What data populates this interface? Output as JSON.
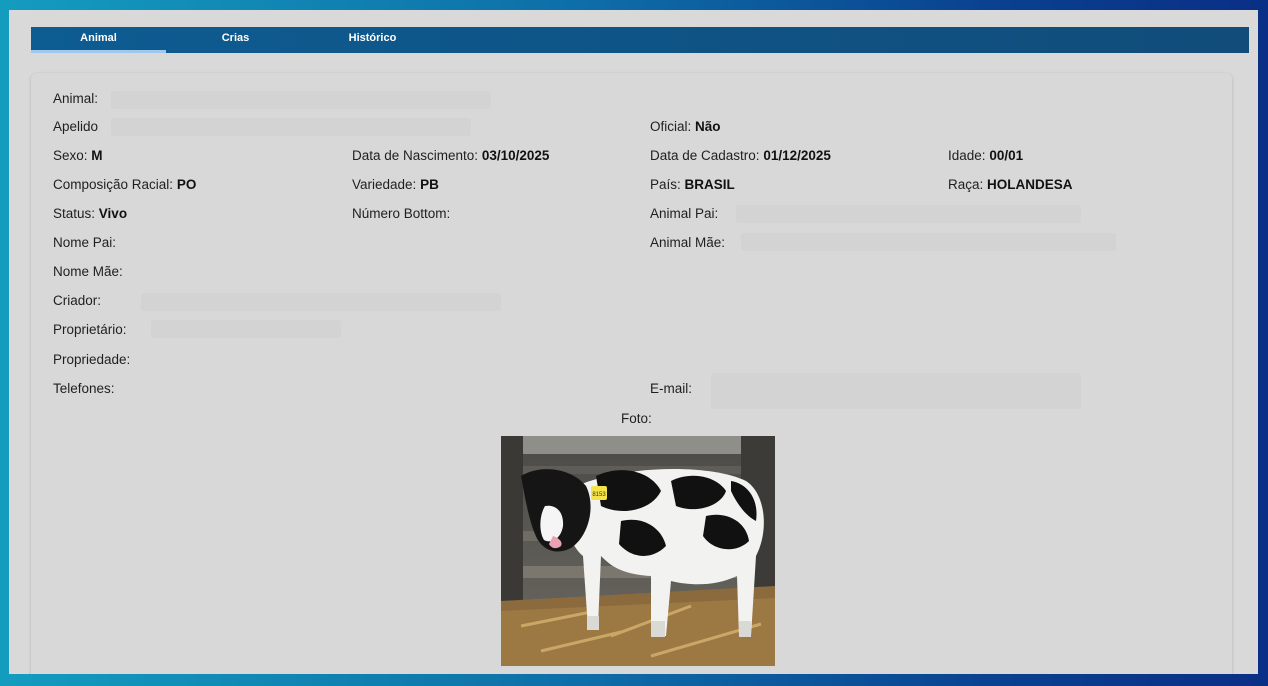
{
  "tabs": [
    {
      "label": "Animal",
      "active": true
    },
    {
      "label": "Crias",
      "active": false
    },
    {
      "label": "Histórico",
      "active": false
    }
  ],
  "fields": {
    "animal": {
      "label": "Animal:",
      "value": ""
    },
    "apelido": {
      "label": "Apelido",
      "value": ""
    },
    "oficial": {
      "label": "Oficial:",
      "value": "Não"
    },
    "sexo": {
      "label": "Sexo:",
      "value": "M"
    },
    "nascimento": {
      "label": "Data de Nascimento:",
      "value": "03/10/2025"
    },
    "cadastro": {
      "label": "Data de Cadastro:",
      "value": "01/12/2025"
    },
    "idade": {
      "label": "Idade:",
      "value": "00/01"
    },
    "composicao": {
      "label": "Composição Racial:",
      "value": "PO"
    },
    "variedade": {
      "label": "Variedade:",
      "value": "PB"
    },
    "pais": {
      "label": "País:",
      "value": "BRASIL"
    },
    "raca": {
      "label": "Raça:",
      "value": "HOLANDESA"
    },
    "status": {
      "label": "Status:",
      "value": "Vivo"
    },
    "bottom": {
      "label": "Número Bottom:",
      "value": ""
    },
    "animal_pai": {
      "label": "Animal Pai:",
      "value": ""
    },
    "nome_pai": {
      "label": "Nome Pai:",
      "value": ""
    },
    "animal_mae": {
      "label": "Animal Mãe:",
      "value": ""
    },
    "nome_mae": {
      "label": "Nome Mãe:",
      "value": ""
    },
    "criador": {
      "label": "Criador:",
      "value": ""
    },
    "proprietario": {
      "label": "Proprietário:",
      "value": ""
    },
    "propriedade": {
      "label": "Propriedade:",
      "value": ""
    },
    "telefones": {
      "label": "Telefones:",
      "value": ""
    },
    "email": {
      "label": "E-mail:",
      "value": ""
    }
  },
  "photo": {
    "label": "Foto:",
    "ear_tag": "8153"
  },
  "colors": {
    "tabbar": "#0d5c92",
    "panel": "#d8d8d8",
    "active_tab_underline": "#9fc8ea"
  }
}
